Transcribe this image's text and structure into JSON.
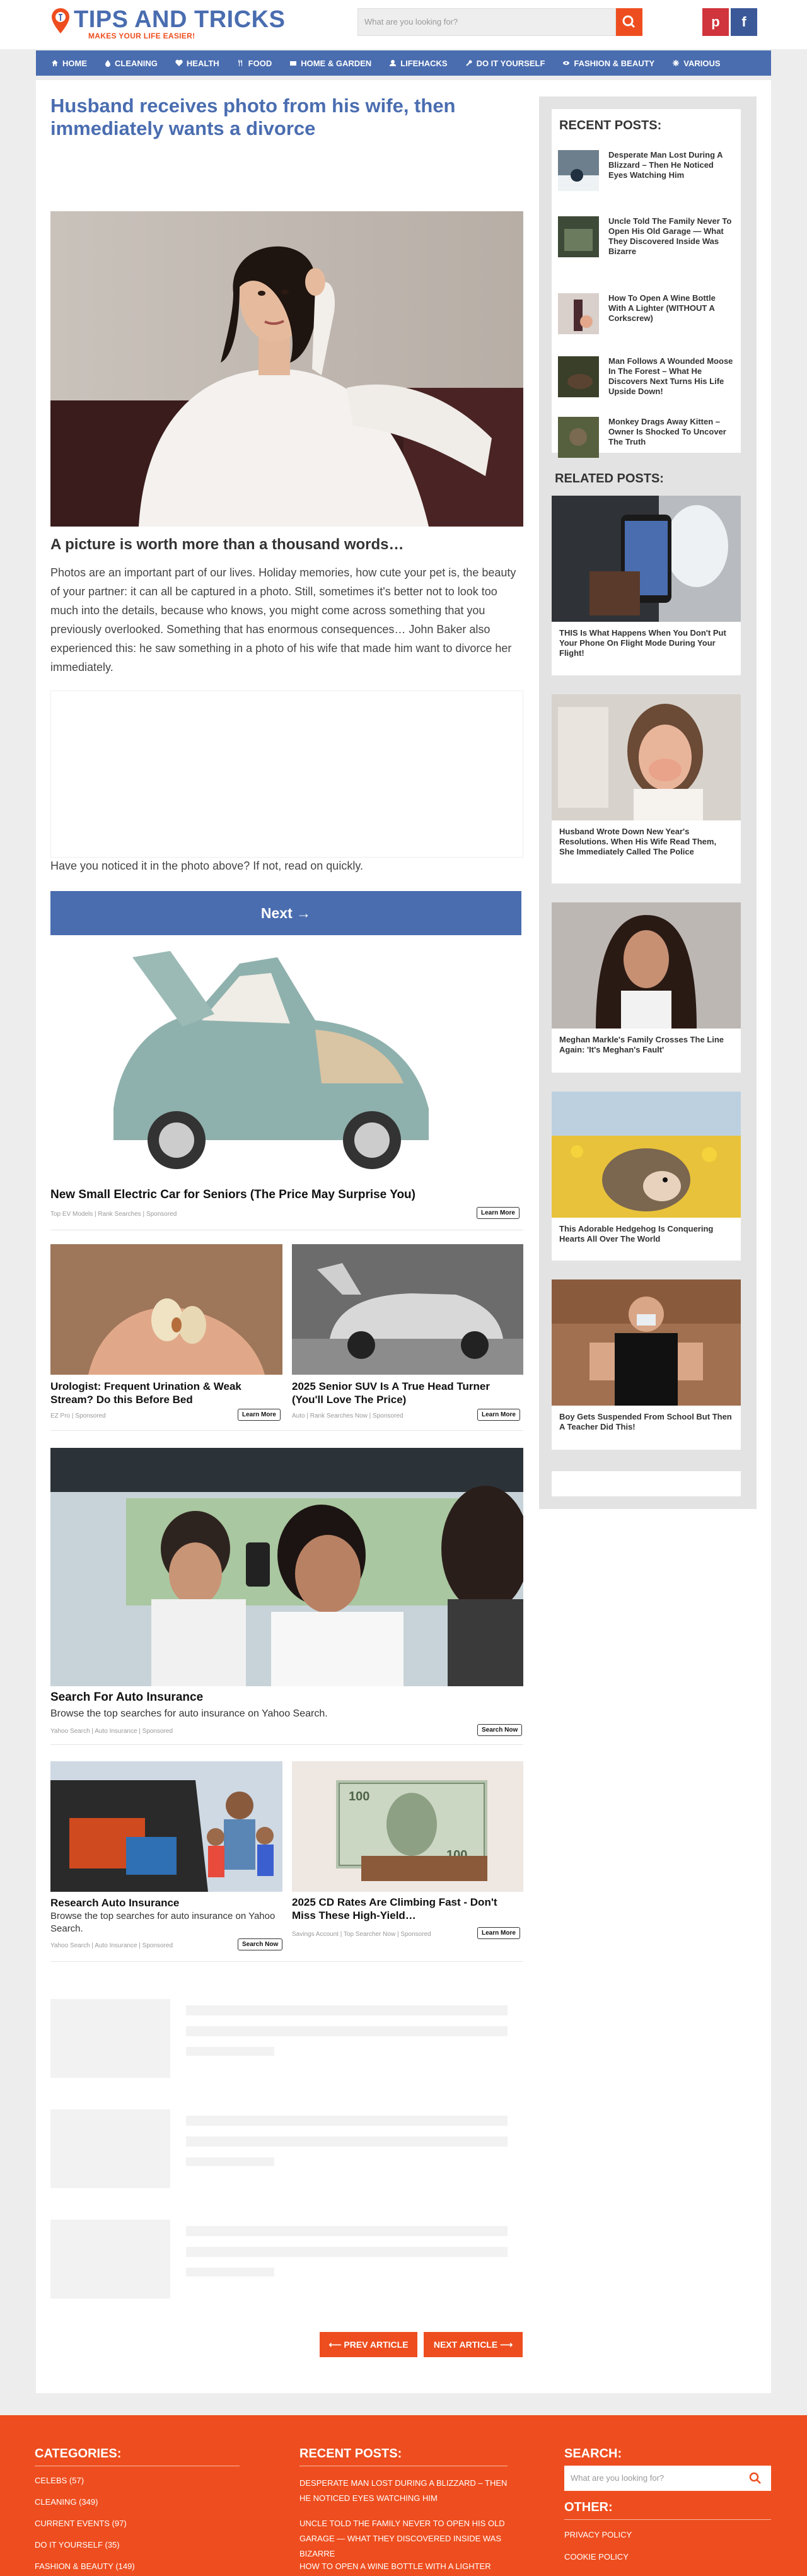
{
  "site": {
    "name": "TIPS AND TRICKS",
    "tagline": "MAKES YOUR LIFE EASIER!",
    "search_placeholder": "What are you looking for?",
    "social": {
      "pinterest": "p",
      "facebook": "f"
    },
    "accent": "#ee4e1f",
    "brand": "#4a6db0"
  },
  "nav": [
    "HOME",
    "CLEANING",
    "HEALTH",
    "FOOD",
    "HOME & GARDEN",
    "LIFEHACKS",
    "DO IT YOURSELF",
    "FASHION & BEAUTY",
    "VARIOUS"
  ],
  "article": {
    "title": "Husband receives photo from his wife, then immediately wants a divorce",
    "subhead": "A picture is worth more than a thousand words…",
    "intro": "Photos are an important part of our lives. Holiday memories, how cute your pet is, the beauty of your partner: it can all be captured in a photo. Still, sometimes it's better not to look too much into the details, because who knows, you might come across something that you previously overlooked. Something that has enormous consequences… John Baker also experienced this: he saw something in a photo of his wife that made him want to divorce her immediately.",
    "question": "Have you noticed it in the photo above? If not, read on quickly.",
    "next_button": "Next →"
  },
  "ads": {
    "car": {
      "title": "New Small Electric Car for Seniors (The Price May Surprise You)",
      "source": "Top EV Models | Rank Searches",
      "sponsored": "Sponsored",
      "cta": "Learn More"
    },
    "uro": {
      "title": "Urologist: Frequent Urination & Weak Stream? Do this Before Bed",
      "source": "EZ Pro",
      "sponsored": "Sponsored",
      "cta": "Learn More"
    },
    "suv": {
      "title": "2025 Senior SUV Is A True Head Turner (You'll Love The Price)",
      "source": "Auto | Rank Searches Now",
      "sponsored": "Sponsored",
      "cta": "Learn More"
    },
    "ins": {
      "title": "Search For Auto Insurance",
      "desc": "Browse the top searches for auto insurance on Yahoo Search.",
      "source": "Yahoo Search | Auto Insurance",
      "sponsored": "Sponsored",
      "cta": "Search Now"
    },
    "ins2": {
      "title": "Research Auto Insurance",
      "desc": "Browse the top searches for auto insurance on Yahoo Search.",
      "source": "Yahoo Search | Auto Insurance",
      "sponsored": "Sponsored",
      "cta": "Search Now"
    },
    "cd": {
      "title": "2025 CD Rates Are Climbing Fast - Don't Miss These High-Yield…",
      "source": "Savings Account | Top Searcher Now",
      "sponsored": "Sponsored",
      "cta": "Learn More"
    }
  },
  "pager": {
    "prev": "⟵ PREV ARTICLE",
    "next": "NEXT ARTICLE ⟶"
  },
  "sidebar": {
    "recent_heading": "RECENT POSTS:",
    "recent": [
      "Desperate Man Lost During A Blizzard – Then He Noticed Eyes Watching Him",
      "Uncle Told The Family Never To Open His Old Garage — What They Discovered Inside Was Bizarre",
      "How To Open A Wine Bottle With A Lighter (WITHOUT A Corkscrew)",
      "Man Follows A Wounded Moose In The Forest – What He Discovers Next Turns His Life Upside Down!",
      "Monkey Drags Away Kitten – Owner Is Shocked To Uncover The Truth"
    ],
    "related_heading": "RELATED POSTS:",
    "related": [
      "THIS Is What Happens When You Don't Put Your Phone On Flight Mode During Your Flight!",
      "Husband Wrote Down New Year's Resolutions. When His Wife Read Them, She Immediately Called The Police",
      "Meghan Markle's Family Crosses The Line Again: 'It's Meghan's Fault'",
      "This Adorable Hedgehog Is Conquering Hearts All Over The World",
      "Boy Gets Suspended From School But Then A Teacher Did This!"
    ]
  },
  "footer": {
    "categories_heading": "CATEGORIES:",
    "categories": [
      "CELEBS (57)",
      "CLEANING (349)",
      "CURRENT EVENTS (97)",
      "DO IT YOURSELF (35)",
      "FASHION & BEAUTY (149)"
    ],
    "recent_heading": "RECENT POSTS:",
    "recent": [
      "DESPERATE MAN LOST DURING A BLIZZARD – THEN HE NOTICED EYES WATCHING HIM",
      "UNCLE TOLD THE FAMILY NEVER TO OPEN HIS OLD GARAGE — WHAT THEY DISCOVERED INSIDE WAS BIZARRE",
      "HOW TO OPEN A WINE BOTTLE WITH A LIGHTER"
    ],
    "search_heading": "SEARCH:",
    "search_placeholder": "What are you looking for?",
    "other_heading": "OTHER:",
    "other": [
      "PRIVACY POLICY",
      "COOKIE POLICY"
    ]
  }
}
